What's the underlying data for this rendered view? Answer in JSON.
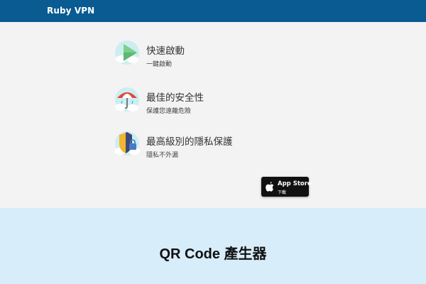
{
  "header": {
    "brand": "Ruby VPN",
    "background_color": "#0a5b91"
  },
  "features": [
    {
      "icon": "play-arrow-cloud-icon",
      "title": "快速啟動",
      "subtitle": "一鍵啟動"
    },
    {
      "icon": "umbrella-cloud-icon",
      "title": "最佳的安全性",
      "subtitle": "保護您遠離危險"
    },
    {
      "icon": "shield-lock-cloud-icon",
      "title": "最高級別的隱私保護",
      "subtitle": "隱私不外漏"
    }
  ],
  "app_store_button": {
    "icon": "apple-icon",
    "label": "App Store",
    "sublabel": "下載"
  },
  "qr_section": {
    "title": "QR Code 產生器",
    "background_color": "#d7edf9"
  }
}
